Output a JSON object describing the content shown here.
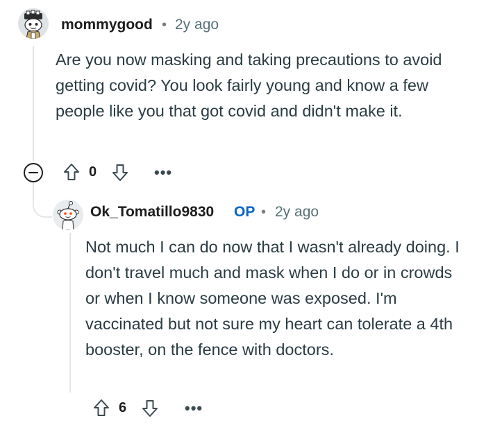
{
  "comment1": {
    "username": "mommygood",
    "separator": "•",
    "timestamp": "2y ago",
    "body": "Are you now masking and taking precautions to avoid getting covid? You look fairly young and know a few people like you that got covid and didn't make it.",
    "vote_count": "0",
    "more_label": "•••"
  },
  "comment2": {
    "username": "Ok_Tomatillo9830",
    "op_badge": "OP",
    "separator": "•",
    "timestamp": "2y ago",
    "body": "Not much I can do now that I wasn't already doing. I don't travel much and mask when I do or in crowds or when I know someone was exposed. I'm vaccinated but not sure my heart can tolerate a 4th booster, on the fence with doctors.",
    "vote_count": "6",
    "more_label": "•••"
  },
  "icons": {
    "collapse": "minus-circle-icon",
    "upvote": "arrow-up-outline-icon",
    "downvote": "arrow-down-outline-icon",
    "more": "ellipsis-icon",
    "avatar1": "snoo-avatar-icon",
    "avatar2": "snoo-avatar-icon"
  },
  "colors": {
    "op_badge": "#0a66c2",
    "thread_line": "#e3e6e8",
    "body_text": "#2a3c42",
    "meta_text": "#576f76"
  }
}
